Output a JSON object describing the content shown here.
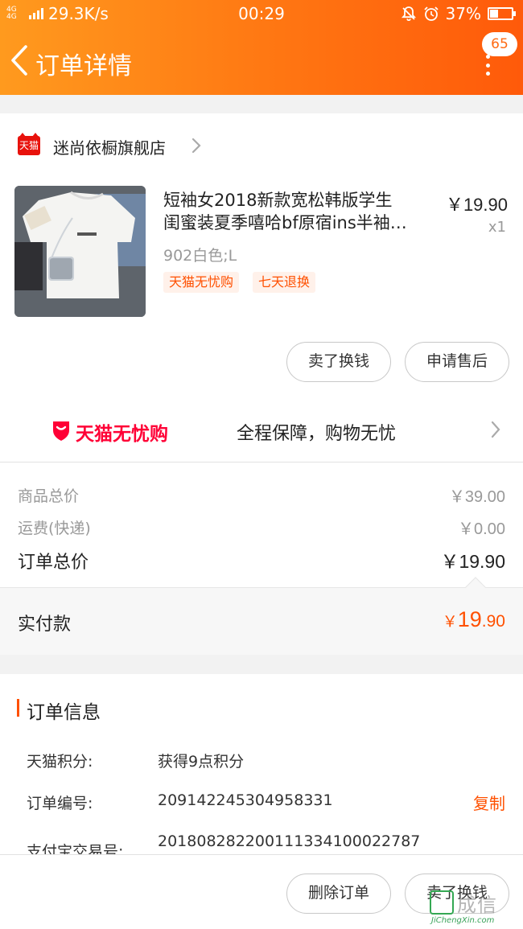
{
  "status_bar": {
    "network_speed": "29.3K/s",
    "time": "00:29",
    "battery": "37%",
    "battery_level": 0.37
  },
  "header": {
    "title": "订单详情",
    "badge_count": "65"
  },
  "store": {
    "name": "迷尚依橱旗舰店",
    "logo_text": "天猫"
  },
  "product": {
    "title_line1": "短袖女2018新款宽松韩版学生",
    "title_line2": "闺蜜装夏季嘻哈bf原宿ins半袖…",
    "price": "￥19.90",
    "quantity": "x1",
    "sku": "902白色;L",
    "tags": [
      "天猫无忧购",
      "七天退换"
    ]
  },
  "item_actions": {
    "sell_label": "卖了换钱",
    "after_sale_label": "申请售后"
  },
  "promo": {
    "brand": "天猫无忧购",
    "text": "全程保障，购物无忧"
  },
  "fees": {
    "goods_total_label": "商品总价",
    "goods_total_value": "￥39.00",
    "shipping_label": "运费(快递)",
    "shipping_value": "￥0.00",
    "order_total_label": "订单总价",
    "order_total_value": "￥19.90"
  },
  "paid": {
    "label": "实付款",
    "currency": "￥",
    "integer": "19",
    "decimal": ".90"
  },
  "order_info": {
    "title": "订单信息",
    "rows": [
      {
        "label": "天猫积分:",
        "value": "获得9点积分"
      },
      {
        "label": "订单编号:",
        "value": "209142245304958331"
      },
      {
        "label": "支付宝交易号:",
        "value": "2018082822001113341000227​87"
      }
    ],
    "copy_label": "复制"
  },
  "bottom_actions": {
    "delete_label": "删除订单",
    "sell_label": "卖了换钱"
  },
  "watermark": {
    "text": "成信",
    "sub": "JiChengXin.com"
  },
  "colors": {
    "accent": "#ff5000",
    "header_start": "#ff9a1e",
    "header_end": "#ff5a0a",
    "tmall_red": "#ff0036"
  }
}
